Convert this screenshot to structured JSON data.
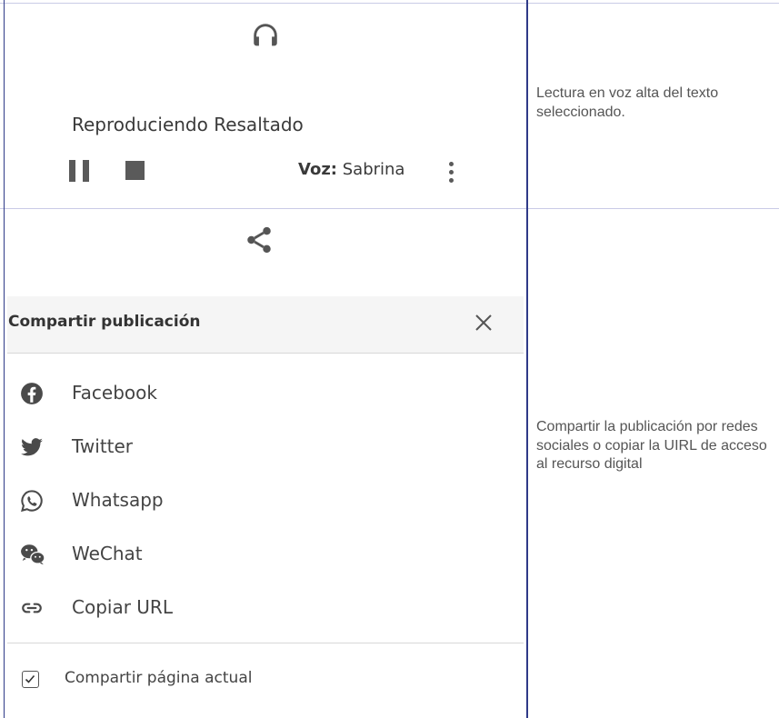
{
  "reader": {
    "icon": "headphones-icon",
    "status": "Reproduciendo Resaltado",
    "voice_label": "Voz:",
    "voice_name": "Sabrina",
    "description": "Lectura en voz alta del texto seleccionado."
  },
  "share": {
    "icon": "share-icon",
    "dialog_title": "Compartir publicación",
    "options": [
      {
        "label": "Facebook",
        "icon": "facebook-icon"
      },
      {
        "label": "Twitter",
        "icon": "twitter-icon"
      },
      {
        "label": "Whatsapp",
        "icon": "whatsapp-icon"
      },
      {
        "label": "WeChat",
        "icon": "wechat-icon"
      },
      {
        "label": "Copiar URL",
        "icon": "link-icon"
      }
    ],
    "checkbox_label": "Compartir página actual",
    "checkbox_checked": true,
    "description": "Compartir la publicación por redes sociales o copiar la UIRL de acceso al recurso digital"
  },
  "colors": {
    "border_accent": "#2f3a88",
    "row_divider": "#c9cbe6",
    "icon_gray": "#5a5a5a"
  }
}
